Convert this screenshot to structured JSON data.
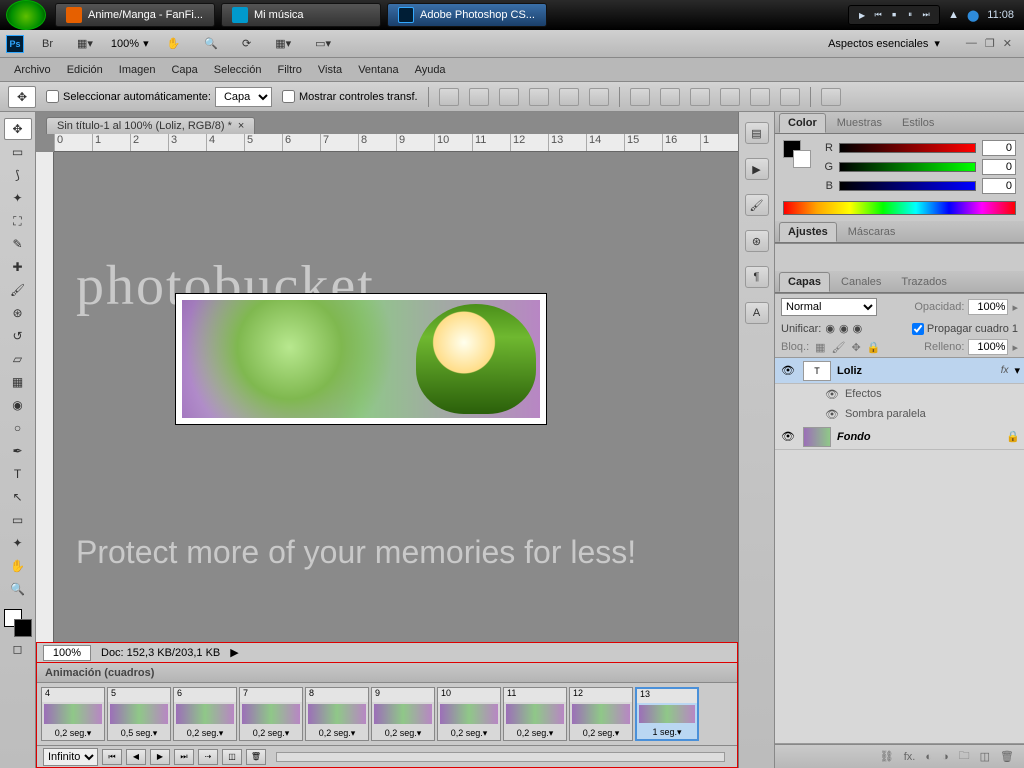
{
  "taskbar": {
    "items": [
      {
        "label": "Anime/Manga - FanFi...",
        "active": false,
        "iconClass": "ff"
      },
      {
        "label": "Mi música",
        "active": false,
        "iconClass": "wmp"
      },
      {
        "label": "Adobe Photoshop CS...",
        "active": true,
        "iconClass": "ps"
      }
    ],
    "clock": "11:08"
  },
  "toprow": {
    "zoom": "100%",
    "workspace": "Aspectos esenciales"
  },
  "menu": [
    "Archivo",
    "Edición",
    "Imagen",
    "Capa",
    "Selección",
    "Filtro",
    "Vista",
    "Ventana",
    "Ayuda"
  ],
  "options": {
    "autoSelect": "Seleccionar automáticamente:",
    "autoTarget": "Capa",
    "transform": "Mostrar controles transf."
  },
  "document": {
    "tab": "Sin título-1 al 100% (Loliz, RGB/8) *",
    "status_zoom": "100%",
    "status_doc": "Doc: 152,3 KB/203,1 KB"
  },
  "ruler_marks": [
    "0",
    "1",
    "2",
    "3",
    "4",
    "5",
    "6",
    "7",
    "8",
    "9",
    "10",
    "11",
    "12",
    "13",
    "14",
    "15",
    "16",
    "1"
  ],
  "animation": {
    "title": "Animación (cuadros)",
    "loop": "Infinito",
    "frames": [
      {
        "n": "4",
        "t": "0,2 seg."
      },
      {
        "n": "5",
        "t": "0,5 seg."
      },
      {
        "n": "6",
        "t": "0,2 seg."
      },
      {
        "n": "7",
        "t": "0,2 seg."
      },
      {
        "n": "8",
        "t": "0,2 seg."
      },
      {
        "n": "9",
        "t": "0,2 seg."
      },
      {
        "n": "10",
        "t": "0,2 seg."
      },
      {
        "n": "11",
        "t": "0,2 seg."
      },
      {
        "n": "12",
        "t": "0,2 seg."
      },
      {
        "n": "13",
        "t": "1 seg.",
        "sel": true
      }
    ]
  },
  "panels": {
    "color": {
      "tabs": [
        "Color",
        "Muestras",
        "Estilos"
      ],
      "r": "0",
      "g": "0",
      "b": "0"
    },
    "adjust": {
      "tabs": [
        "Ajustes",
        "Máscaras"
      ]
    },
    "layers": {
      "tabs": [
        "Capas",
        "Canales",
        "Trazados"
      ],
      "blend": "Normal",
      "opacity_label": "Opacidad:",
      "opacity": "100%",
      "unify": "Unificar:",
      "propagate": "Propagar cuadro 1",
      "lock": "Bloq.:",
      "fill_label": "Relleno:",
      "fill": "100%",
      "items": [
        {
          "name": "Loliz",
          "type": "T",
          "sel": true,
          "fx": "fx"
        },
        {
          "name": "Fondo",
          "type": "bg",
          "locked": true
        }
      ],
      "fx_label": "Efectos",
      "fx_item": "Sombra paralela"
    }
  },
  "watermark": {
    "logo": "photobucket",
    "tagline": "Protect more of your memories for less!"
  }
}
